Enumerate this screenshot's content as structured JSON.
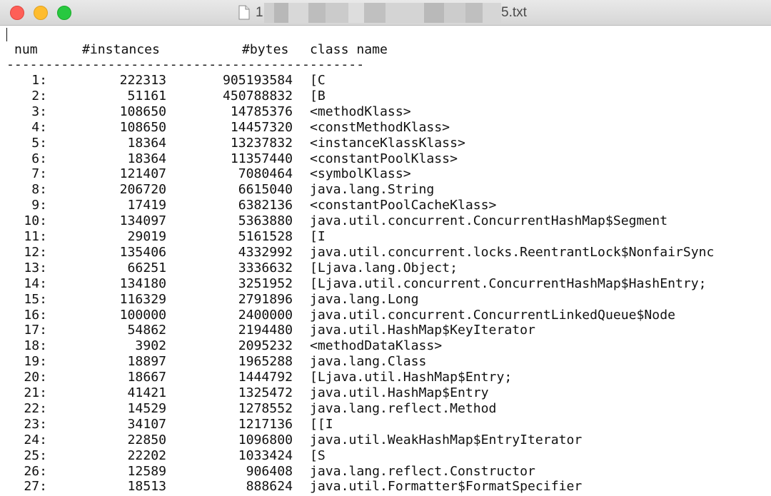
{
  "window": {
    "title_prefix": "1",
    "title_suffix": "5.txt"
  },
  "table": {
    "headers": {
      "num": "num",
      "instances": "#instances",
      "bytes": "#bytes",
      "class_name": "class name"
    },
    "separator": "----------------------------------------------",
    "rows": [
      {
        "num": "1:",
        "instances": "222313",
        "bytes": "905193584",
        "class_name": "[C"
      },
      {
        "num": "2:",
        "instances": "51161",
        "bytes": "450788832",
        "class_name": "[B"
      },
      {
        "num": "3:",
        "instances": "108650",
        "bytes": "14785376",
        "class_name": "<methodKlass>"
      },
      {
        "num": "4:",
        "instances": "108650",
        "bytes": "14457320",
        "class_name": "<constMethodKlass>"
      },
      {
        "num": "5:",
        "instances": "18364",
        "bytes": "13237832",
        "class_name": "<instanceKlassKlass>"
      },
      {
        "num": "6:",
        "instances": "18364",
        "bytes": "11357440",
        "class_name": "<constantPoolKlass>"
      },
      {
        "num": "7:",
        "instances": "121407",
        "bytes": "7080464",
        "class_name": "<symbolKlass>"
      },
      {
        "num": "8:",
        "instances": "206720",
        "bytes": "6615040",
        "class_name": "java.lang.String"
      },
      {
        "num": "9:",
        "instances": "17419",
        "bytes": "6382136",
        "class_name": "<constantPoolCacheKlass>"
      },
      {
        "num": "10:",
        "instances": "134097",
        "bytes": "5363880",
        "class_name": "java.util.concurrent.ConcurrentHashMap$Segment"
      },
      {
        "num": "11:",
        "instances": "29019",
        "bytes": "5161528",
        "class_name": "[I"
      },
      {
        "num": "12:",
        "instances": "135406",
        "bytes": "4332992",
        "class_name": "java.util.concurrent.locks.ReentrantLock$NonfairSync"
      },
      {
        "num": "13:",
        "instances": "66251",
        "bytes": "3336632",
        "class_name": "[Ljava.lang.Object;"
      },
      {
        "num": "14:",
        "instances": "134180",
        "bytes": "3251952",
        "class_name": "[Ljava.util.concurrent.ConcurrentHashMap$HashEntry;"
      },
      {
        "num": "15:",
        "instances": "116329",
        "bytes": "2791896",
        "class_name": "java.lang.Long"
      },
      {
        "num": "16:",
        "instances": "100000",
        "bytes": "2400000",
        "class_name": "java.util.concurrent.ConcurrentLinkedQueue$Node"
      },
      {
        "num": "17:",
        "instances": "54862",
        "bytes": "2194480",
        "class_name": "java.util.HashMap$KeyIterator"
      },
      {
        "num": "18:",
        "instances": "3902",
        "bytes": "2095232",
        "class_name": "<methodDataKlass>"
      },
      {
        "num": "19:",
        "instances": "18897",
        "bytes": "1965288",
        "class_name": "java.lang.Class"
      },
      {
        "num": "20:",
        "instances": "18667",
        "bytes": "1444792",
        "class_name": "[Ljava.util.HashMap$Entry;"
      },
      {
        "num": "21:",
        "instances": "41421",
        "bytes": "1325472",
        "class_name": "java.util.HashMap$Entry"
      },
      {
        "num": "22:",
        "instances": "14529",
        "bytes": "1278552",
        "class_name": "java.lang.reflect.Method"
      },
      {
        "num": "23:",
        "instances": "34107",
        "bytes": "1217136",
        "class_name": "[[I"
      },
      {
        "num": "24:",
        "instances": "22850",
        "bytes": "1096800",
        "class_name": "java.util.WeakHashMap$EntryIterator"
      },
      {
        "num": "25:",
        "instances": "22202",
        "bytes": "1033424",
        "class_name": "[S"
      },
      {
        "num": "26:",
        "instances": "12589",
        "bytes": "906408",
        "class_name": "java.lang.reflect.Constructor"
      },
      {
        "num": "27:",
        "instances": "18513",
        "bytes": "888624",
        "class_name": "java.util.Formatter$FormatSpecifier"
      }
    ]
  }
}
